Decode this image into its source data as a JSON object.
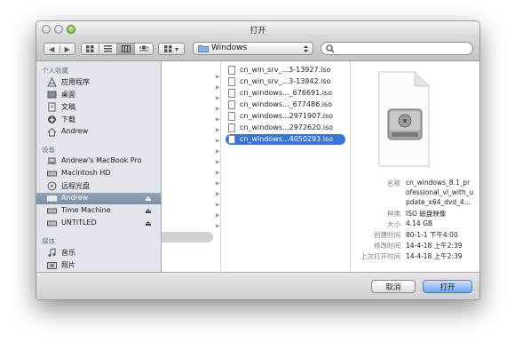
{
  "window": {
    "title": "打开"
  },
  "toolbar": {
    "back_glyph": "◀",
    "forward_glyph": "▶",
    "view_icons": [
      "icon-view-icon",
      "list-view-icon",
      "column-view-icon",
      "coverflow-view-icon"
    ],
    "arrange_glyph": "▾",
    "location": "Windows",
    "search_value": ""
  },
  "sidebar": {
    "sections": [
      {
        "title": "个人收藏",
        "items": [
          {
            "label": "应用程序",
            "icon": "applications-icon"
          },
          {
            "label": "桌面",
            "icon": "desktop-icon"
          },
          {
            "label": "文稿",
            "icon": "documents-icon"
          },
          {
            "label": "下载",
            "icon": "downloads-icon"
          },
          {
            "label": "Andrew",
            "icon": "home-icon"
          }
        ]
      },
      {
        "title": "设备",
        "items": [
          {
            "label": "Andrew's MacBook Pro",
            "icon": "laptop-icon"
          },
          {
            "label": "Macintosh HD",
            "icon": "hard-drive-icon"
          },
          {
            "label": "远程光盘",
            "icon": "remote-disc-icon"
          },
          {
            "label": "Andrew",
            "icon": "drive-icon",
            "selected": true,
            "eject": true
          },
          {
            "label": "Time Machine",
            "icon": "drive-icon",
            "eject": true
          },
          {
            "label": "UNTITLED",
            "icon": "drive-icon",
            "eject": true
          }
        ]
      },
      {
        "title": "媒体",
        "items": [
          {
            "label": "音乐",
            "icon": "music-icon"
          },
          {
            "label": "照片",
            "icon": "photos-icon"
          }
        ]
      }
    ],
    "eject_glyph": "⏏"
  },
  "files": [
    {
      "name": "cn_win_srv_...3-13927.iso"
    },
    {
      "name": "cn_win_srv_...3-13942.iso"
    },
    {
      "name": "cn_windows..._676691.iso"
    },
    {
      "name": "cn_windows..._677486.iso"
    },
    {
      "name": "cn_windows...2971907.iso"
    },
    {
      "name": "cn_windows...2972620.iso"
    },
    {
      "name": "cn_windows...4050293.iso",
      "selected": true
    }
  ],
  "preview": {
    "rows": [
      {
        "key": "名称",
        "value": "cn_windows_8.1_pr"
      },
      {
        "key": "",
        "value": "ofessional_vl_with_u"
      },
      {
        "key": "",
        "value": "pdate_x64_dvd_4..."
      },
      {
        "key": "种类",
        "value": "ISO 磁盘映像"
      },
      {
        "key": "大小",
        "value": "4.14 GB"
      },
      {
        "key": "创建时间",
        "value": "80-1-1 下午4:00"
      },
      {
        "key": "修改时间",
        "value": "14-4-18 上午2:39"
      },
      {
        "key": "上次打开时间",
        "value": "14-4-18 上午2:39"
      }
    ]
  },
  "footer": {
    "cancel_label": "取消",
    "open_label": "打开"
  }
}
